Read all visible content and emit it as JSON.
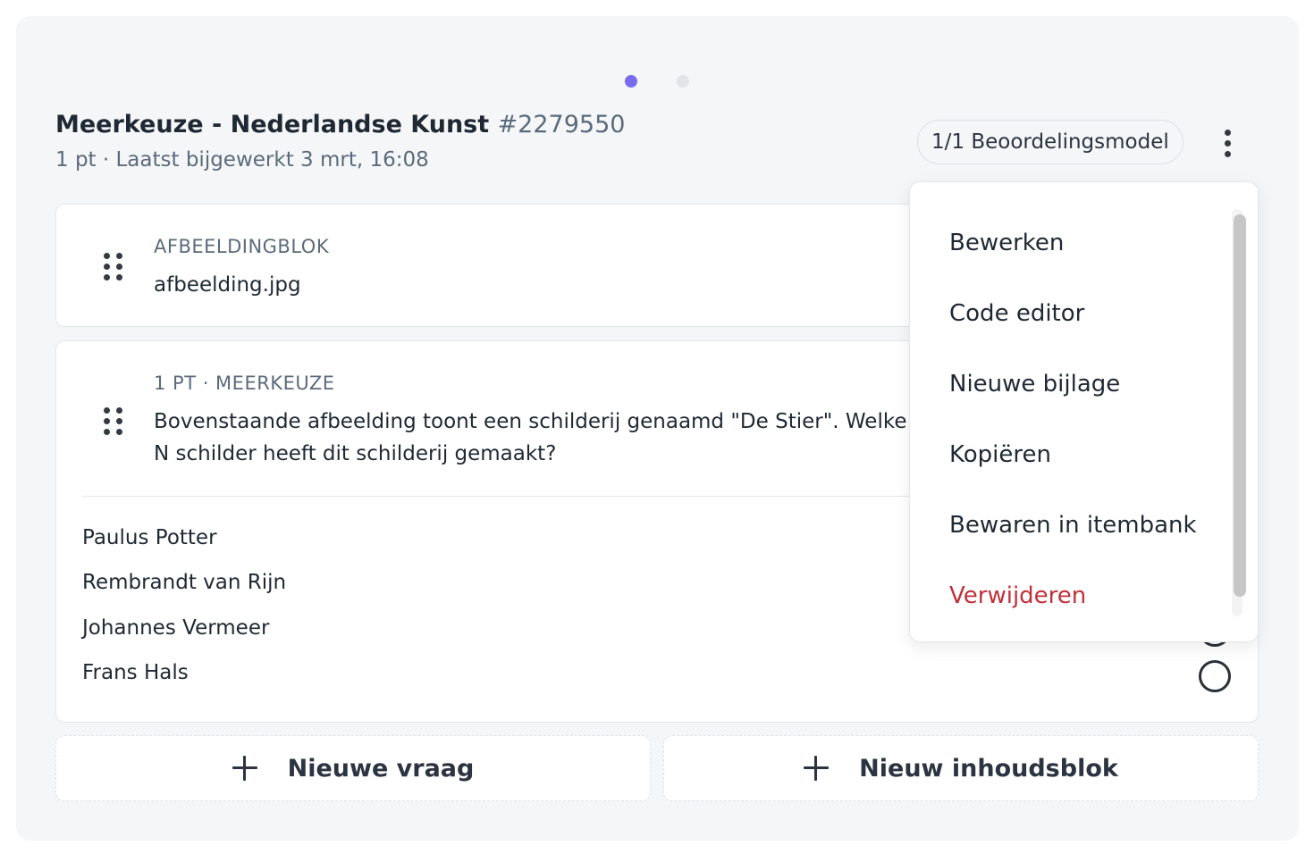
{
  "pager": {
    "count": 2,
    "active_index": 0
  },
  "header": {
    "title": "Meerkeuze - Nederlandse Kunst",
    "id": "#2279550",
    "subtitle": "1 pt · Laatst bijgewerkt 3 mrt, 16:08",
    "rubric_label": "1/1 Beoordelingsmodel"
  },
  "image_block": {
    "eyebrow": "AFBEELDINGBLOK",
    "filename": "afbeelding.jpg"
  },
  "question_block": {
    "eyebrow": "1 PT · MEERKEUZE",
    "text": "Bovenstaande afbeelding toont een schilderij genaamd \"De Stier\". Welke N schilder heeft dit schilderij gemaakt?",
    "options": [
      {
        "label": "Paulus Potter"
      },
      {
        "label": "Rembrandt van Rijn"
      },
      {
        "label": "Johannes Vermeer"
      },
      {
        "label": "Frans Hals"
      }
    ]
  },
  "actions": {
    "new_question": "Nieuwe vraag",
    "new_content_block": "Nieuw inhoudsblok"
  },
  "menu": {
    "items": [
      {
        "label": "Bewerken"
      },
      {
        "label": "Code editor"
      },
      {
        "label": "Nieuwe bijlage"
      },
      {
        "label": "Kopiëren"
      },
      {
        "label": "Bewaren in itembank"
      },
      {
        "label": "Verwijderen",
        "danger": true
      }
    ]
  },
  "colors": {
    "accent": "#7a6cf0",
    "danger": "#c0313a",
    "panel_bg": "#f5f6f8",
    "muted_text": "#5b6b7b"
  }
}
